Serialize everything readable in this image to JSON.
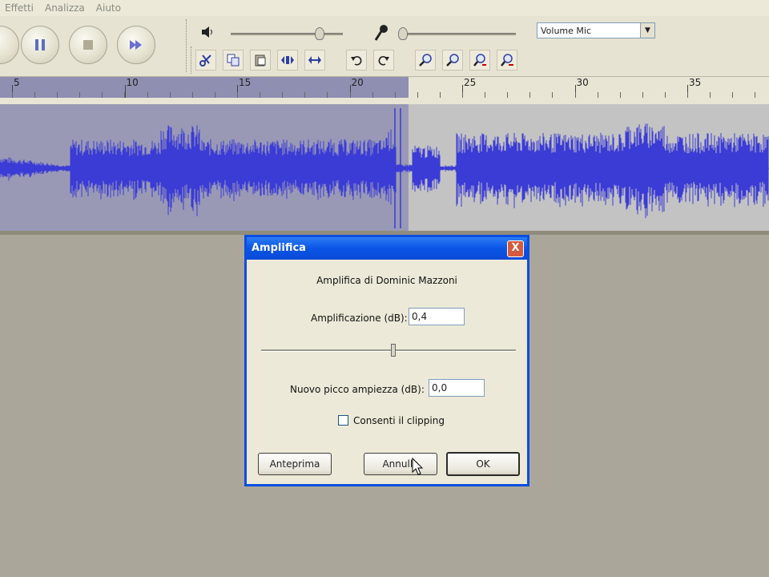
{
  "menu": {
    "items": [
      "Effetti",
      "Analizza",
      "Aiuto"
    ]
  },
  "toolbar": {
    "mic_source": "Volume Mic"
  },
  "ruler": {
    "labels": [
      "5",
      "10",
      "15",
      "20",
      "25",
      "30",
      "35"
    ]
  },
  "dialog": {
    "title": "Amplifica",
    "close_label": "X",
    "heading": "Amplifica di Dominic Mazzoni",
    "amp_label": "Amplificazione (dB):",
    "amp_value": "0,4",
    "peak_label": "Nuovo picco ampiezza (dB):",
    "peak_value": "0,0",
    "clip_label": "Consenti il clipping",
    "clip_checked": false,
    "preview_label": "Anteprima",
    "cancel_label": "Annulla",
    "ok_label": "OK"
  },
  "colors": {
    "waveform": "#3b3bd6",
    "selection": "#9999b6",
    "titlebar": "#0a55e6"
  }
}
